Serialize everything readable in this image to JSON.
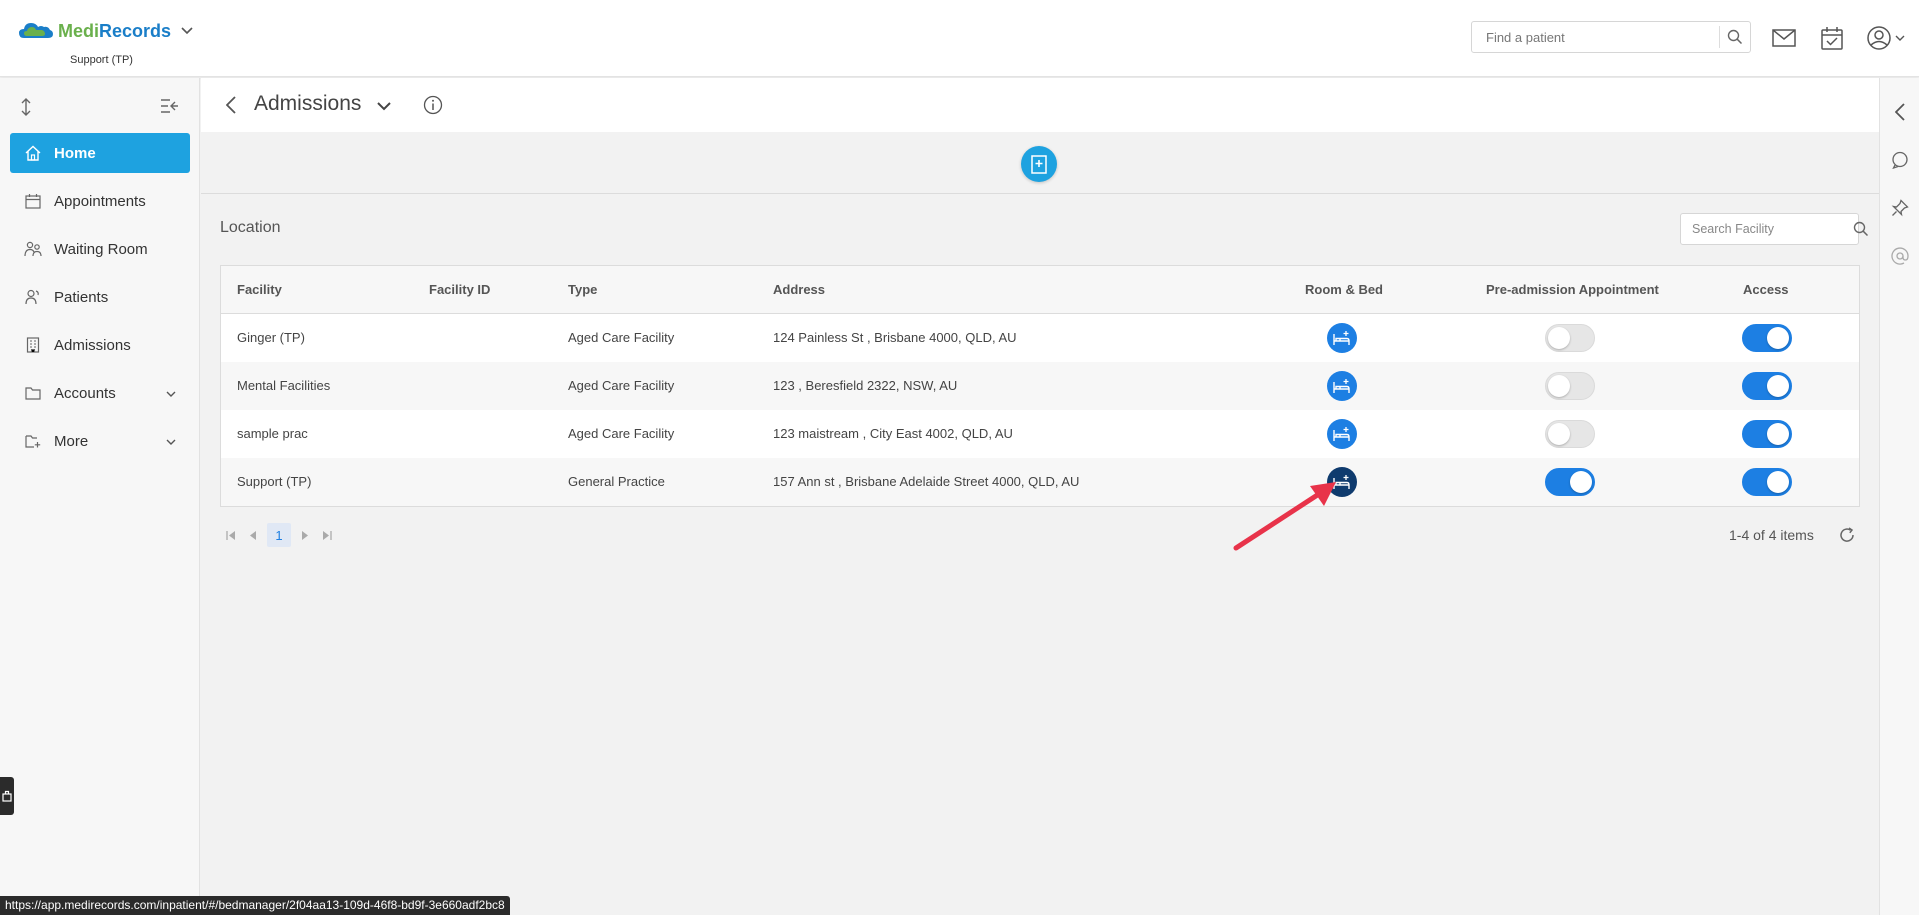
{
  "header": {
    "logo_medi": "Medi",
    "logo_records": "Records",
    "org_name": "Support (TP)",
    "search_placeholder": "Find a patient"
  },
  "sidebar": {
    "items": [
      {
        "label": "Home",
        "icon": "home-icon",
        "active": true
      },
      {
        "label": "Appointments",
        "icon": "calendar-icon"
      },
      {
        "label": "Waiting Room",
        "icon": "people-icon"
      },
      {
        "label": "Patients",
        "icon": "patients-icon"
      },
      {
        "label": "Admissions",
        "icon": "building-icon"
      },
      {
        "label": "Accounts",
        "icon": "folder-icon",
        "expandable": true
      },
      {
        "label": "More",
        "icon": "folder-plus-icon",
        "expandable": true
      }
    ]
  },
  "page": {
    "title": "Admissions",
    "section_label": "Location",
    "search_facility_placeholder": "Search Facility"
  },
  "table": {
    "columns": [
      "Facility",
      "Facility ID",
      "Type",
      "Address",
      "Room & Bed",
      "Pre-admission Appointment",
      "Access"
    ],
    "rows": [
      {
        "facility": "Ginger (TP)",
        "facility_id": "",
        "type": "Aged Care Facility",
        "address": "124 Painless St , Brisbane 4000, QLD, AU",
        "preadmission": false,
        "access": true
      },
      {
        "facility": "Mental Facilities",
        "facility_id": "",
        "type": "Aged Care Facility",
        "address": "123 , Beresfield 2322, NSW, AU",
        "preadmission": false,
        "access": true
      },
      {
        "facility": "sample prac",
        "facility_id": "",
        "type": "Aged Care Facility",
        "address": "123 maistream , City East 4002, QLD, AU",
        "preadmission": false,
        "access": true
      },
      {
        "facility": "Support (TP)",
        "facility_id": "",
        "type": "General Practice",
        "address": "157 Ann st , Brisbane Adelaide Street 4000, QLD, AU",
        "preadmission": true,
        "access": true
      }
    ]
  },
  "pager": {
    "current_page": "1",
    "info": "1-4 of 4 items"
  },
  "status_bar": {
    "url": "https://app.medirecords.com/inpatient/#/bedmanager/2f04aa13-109d-46f8-bd9f-3e660adf2bc8"
  },
  "colors": {
    "accent": "#1ea2e0",
    "toggle_on": "#1d7fe3",
    "annotation_arrow": "#e8334a"
  }
}
